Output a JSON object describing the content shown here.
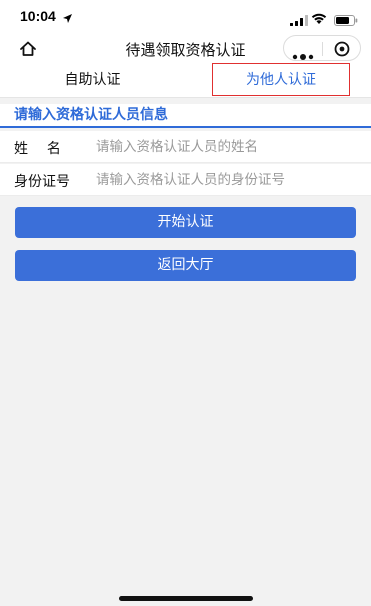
{
  "status_bar": {
    "time": "10:04",
    "icons": [
      "location-arrow-icon",
      "cellular-signal-icon",
      "wifi-icon",
      "battery-icon"
    ]
  },
  "nav": {
    "title": "待遇领取资格认证",
    "home_icon": "home-icon",
    "more_icon": "more-dots-icon",
    "close_icon": "close-circle-icon"
  },
  "tabs": [
    {
      "label": "自助认证",
      "active": false
    },
    {
      "label": "为他人认证",
      "active": true
    }
  ],
  "form": {
    "section_title": "请输入资格认证人员信息",
    "fields": [
      {
        "label": "姓名",
        "placeholder": "请输入资格认证人员的姓名",
        "value": ""
      },
      {
        "label": "身份证号",
        "placeholder": "请输入资格认证人员的身份证号",
        "value": ""
      }
    ]
  },
  "buttons": {
    "start": "开始认证",
    "back": "返回大厅"
  },
  "colors": {
    "accent": "#3b6fd9",
    "active_tab_text": "#2f6bd8",
    "highlight_border": "#e03030",
    "background": "#f2f2f2"
  }
}
